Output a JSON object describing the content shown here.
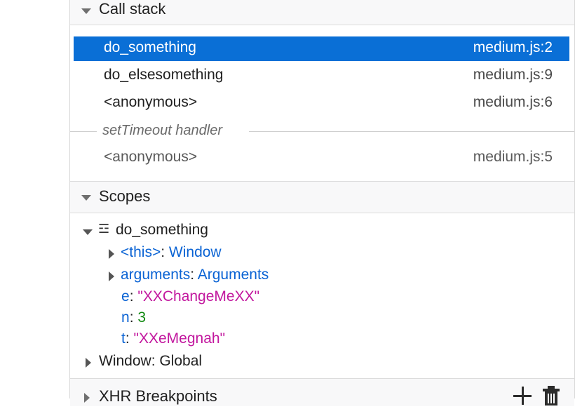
{
  "call_stack": {
    "title": "Call stack",
    "frames": [
      {
        "name": "do_something",
        "location": "medium.js:2"
      },
      {
        "name": "do_elsesomething",
        "location": "medium.js:9"
      },
      {
        "name": "<anonymous>",
        "location": "medium.js:6"
      }
    ],
    "async_label": "setTimeout handler",
    "async_frames": [
      {
        "name": "<anonymous>",
        "location": "medium.js:5"
      }
    ]
  },
  "scopes": {
    "title": "Scopes",
    "scope_name": "do_something",
    "this_key": "<this>",
    "this_value": "Window",
    "arguments_key": "arguments",
    "arguments_value": "Arguments",
    "vars": [
      {
        "key": "e",
        "value": "\"XXChangeMeXX\""
      },
      {
        "key": "n",
        "value": "3"
      },
      {
        "key": "t",
        "value": "\"XXeMegnah\""
      }
    ],
    "colon": ":",
    "window_label": "Window: Global"
  },
  "xhr_breakpoints": {
    "title": "XHR Breakpoints",
    "add_icon": "plus-icon",
    "remove_icon": "trash-icon"
  },
  "colors": {
    "selected_bg": "#0a6fd6",
    "key_blue": "#0a63d4",
    "string_magenta": "#c2179e",
    "number_green": "#128a12"
  }
}
